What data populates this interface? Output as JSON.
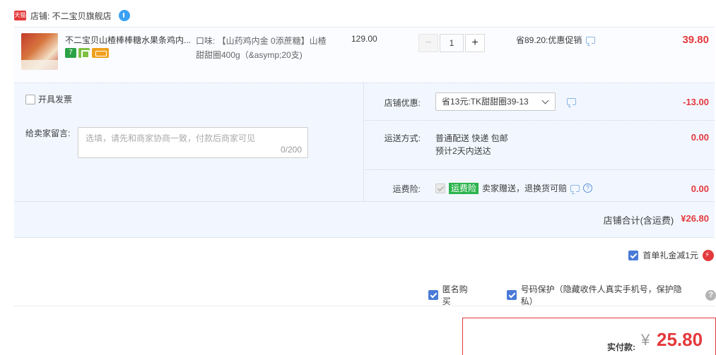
{
  "shop": {
    "tmall_badge": "天猫",
    "label": "店铺: 不二宝贝旗舰店"
  },
  "item": {
    "title": "不二宝贝山楂棒棒糖水果条鸡内...",
    "badge_1": "7",
    "sku": "口味: 【山药鸡内金 0添蔗糖】山楂甜甜圈400g（&asymp;20支)",
    "unit_price": "129.00",
    "quantity": "1",
    "promo": "省89.20:优惠促销",
    "subtotal": "39.80"
  },
  "invoice": {
    "label": "开具发票"
  },
  "memo": {
    "label": "给卖家留言:",
    "placeholder": "选填，请先和商家协商一致，付款后商家可见",
    "count": "0/200"
  },
  "shop_discount": {
    "label": "店铺优惠:",
    "selected": "省13元:TK甜甜圈39-13",
    "amount": "-13.00"
  },
  "shipping": {
    "label": "运送方式:",
    "method": "普通配送 快递 包邮",
    "eta": "预计2天内送达",
    "amount": "0.00"
  },
  "insurance": {
    "label": "运费险:",
    "tag": "运费险",
    "text": "卖家赠送，退换货可赔",
    "amount": "0.00"
  },
  "shop_total": {
    "label": "店铺合计(含运费)",
    "amount": "¥26.80"
  },
  "gift": {
    "label": "首单礼金减1元"
  },
  "privacy": {
    "anonymous": "匿名购买",
    "number_protect": "号码保护（隐藏收件人真实手机号，保护隐私）"
  },
  "payment": {
    "label": "实付款:",
    "currency": "¥",
    "amount": "25.80"
  },
  "colors": {
    "accent_red": "#e4393c",
    "panel_blue": "#f2f7ff",
    "check_blue": "#4a7ad8",
    "insure_green": "#2bb34b"
  }
}
